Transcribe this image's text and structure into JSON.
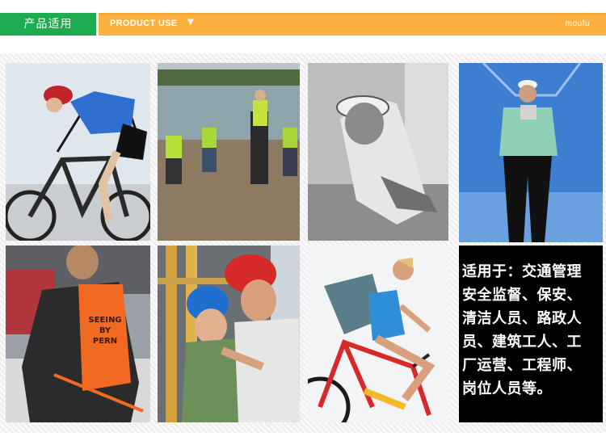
{
  "header": {
    "title_cn": "产品适用",
    "title_en": "PRODUCT USE",
    "dropdown_arrow": "▼",
    "brand": "moufu"
  },
  "photos": {
    "vest_text": "SEEING BY PERN"
  },
  "notice": {
    "lines": [
      "适用于：交通管理",
      "安全监督、保安、",
      "清洁人员、路政人",
      "员、建筑工人、工",
      "厂运营、工程师、",
      "岗位人员等。"
    ]
  },
  "colors": {
    "green": "#1cab4f",
    "orange": "#fbb040",
    "notice_bg": "#000000"
  }
}
